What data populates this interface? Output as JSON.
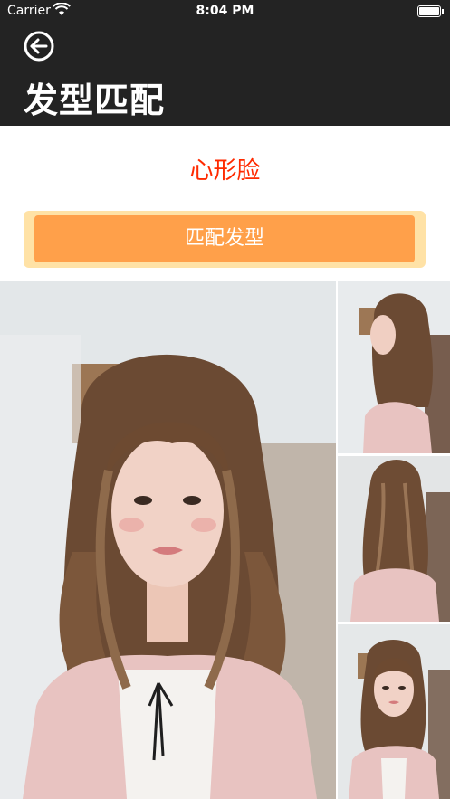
{
  "status_bar": {
    "carrier": "Carrier",
    "time": "8:04 PM"
  },
  "nav": {
    "back_icon": "back-arrow-circle-icon",
    "title": "发型匹配"
  },
  "face_type": {
    "label": "心形脸",
    "color": "#ff2a00"
  },
  "match_button": {
    "label": "匹配发型",
    "color": "#ffa04a",
    "border_color": "#ffe2a6"
  },
  "gallery": {
    "main_image": "hairstyle-main-photo",
    "thumbnails": [
      "hairstyle-side-view",
      "hairstyle-back-view",
      "hairstyle-front-view"
    ]
  },
  "colors": {
    "header_background": "#232323",
    "accent": "#ffa04a"
  }
}
